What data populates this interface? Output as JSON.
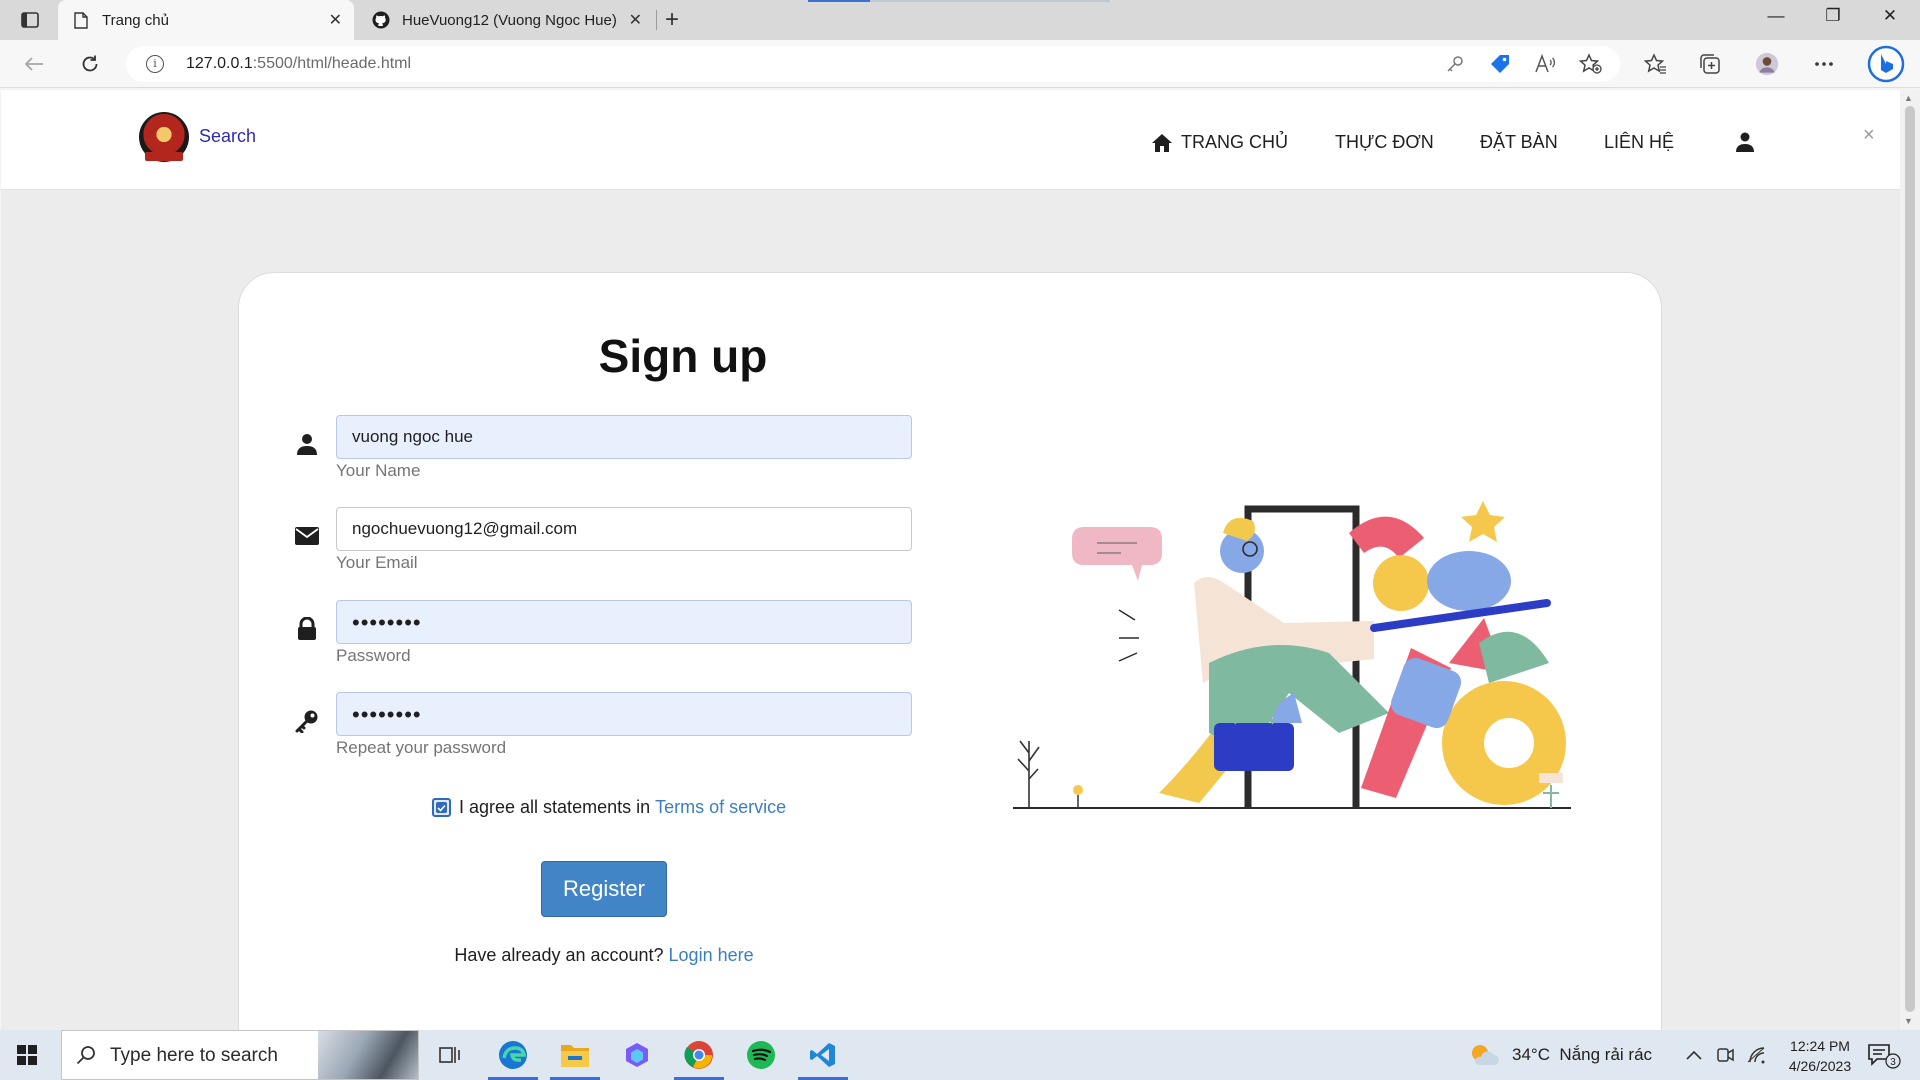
{
  "browser": {
    "tabs": [
      {
        "title": "Trang chủ",
        "active": true
      },
      {
        "title": "HueVuong12 (Vuong Ngoc Hue)",
        "active": false
      }
    ],
    "url_host": "127.0.0.1",
    "url_rest": ":5500/html/heade.html"
  },
  "site": {
    "brand": "Search",
    "menu": [
      "TRANG CHỦ",
      "THỰC ĐƠN",
      "ĐẶT BÀN",
      "LIÊN HỆ"
    ],
    "close": "×"
  },
  "form": {
    "title": "Sign up",
    "name_value": "vuong ngoc hue",
    "name_label": "Your Name",
    "email_value": "ngochuevuong12@gmail.com",
    "email_label": "Your Email",
    "password_value": "••••••••",
    "password_label": "Password",
    "repeat_value": "••••••••",
    "repeat_label": "Repeat your password",
    "agree_text": "I agree all statements in ",
    "terms_link": "Terms of service",
    "agree_checked": true,
    "register_label": "Register",
    "login_prompt": "Have already an account? ",
    "login_link": "Login here"
  },
  "taskbar": {
    "search_placeholder": "Type here to search",
    "weather": "34°C  Nắng rải rác",
    "time": "12:24 PM",
    "date": "4/26/2023",
    "notifications": "3"
  },
  "colors": {
    "accent": "#4285c6",
    "link": "#3a7fc1",
    "brand_text": "#2f2bb0"
  }
}
